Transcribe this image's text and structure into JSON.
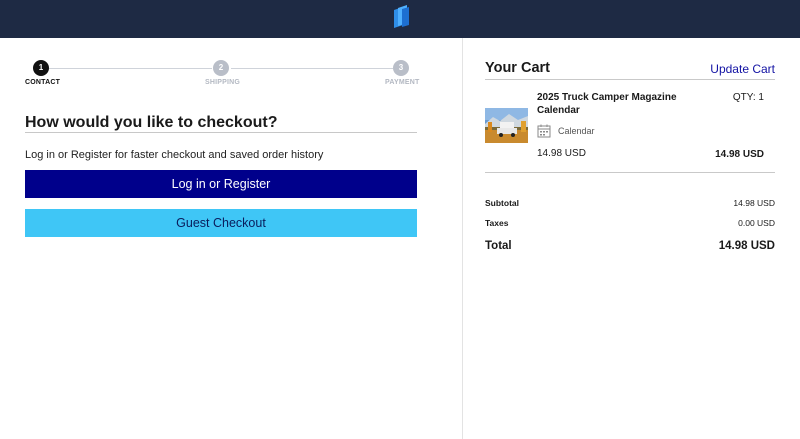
{
  "header": {
    "logo_icon": "book-logo-icon",
    "background_color": "#1e2a44"
  },
  "stepper": {
    "steps": [
      {
        "number": "1",
        "label": "CONTACT",
        "state": "active"
      },
      {
        "number": "2",
        "label": "SHIPPING",
        "state": "inactive"
      },
      {
        "number": "3",
        "label": "PAYMENT",
        "state": "inactive"
      }
    ]
  },
  "checkout": {
    "heading": "How would you like to checkout?",
    "subtext": "Log in or Register for faster checkout and saved order history",
    "login_button": "Log in or Register",
    "guest_button": "Guest Checkout",
    "login_button_color": "#00008b",
    "guest_button_color": "#3fc6f6"
  },
  "cart": {
    "title": "Your Cart",
    "update_link": "Update Cart",
    "item": {
      "name": "2025 Truck Camper Magazine Calendar",
      "qty_label": "QTY: 1",
      "type_icon": "calendar-icon",
      "type": "Calendar",
      "unit_price": "14.98 USD",
      "line_total": "14.98 USD"
    },
    "summary": {
      "subtotal_label": "Subtotal",
      "subtotal_value": "14.98 USD",
      "taxes_label": "Taxes",
      "taxes_value": "0.00 USD",
      "total_label": "Total",
      "total_value": "14.98 USD"
    }
  }
}
